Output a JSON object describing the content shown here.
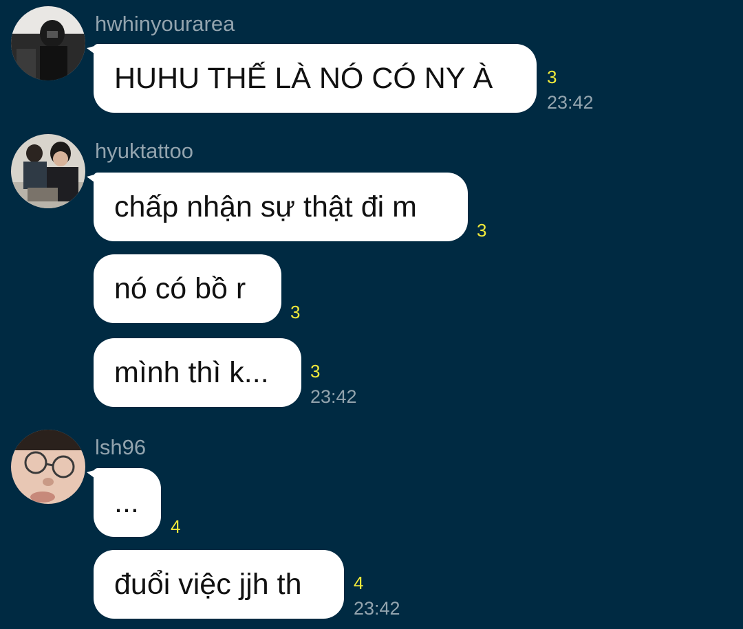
{
  "messages_groups": [
    {
      "username": "hwhinyourarea",
      "avatar_icon": "user-avatar-photo",
      "messages": [
        {
          "text": "HUHU THẾ LÀ NÓ CÓ NY À",
          "unread": "3",
          "time": "23:42"
        }
      ]
    },
    {
      "username": "hyuktattoo",
      "avatar_icon": "user-avatar-photo",
      "messages": [
        {
          "text": "chấp nhận sự thật đi m",
          "unread": "3"
        },
        {
          "text": "nó có bồ r",
          "unread": "3"
        },
        {
          "text": "mình thì k...",
          "unread": "3",
          "time": "23:42"
        }
      ]
    },
    {
      "username": "lsh96",
      "avatar_icon": "user-avatar-photo",
      "messages": [
        {
          "text": "...",
          "unread": "4"
        },
        {
          "text": "đuổi việc jjh th",
          "unread": "4",
          "time": "23:42"
        }
      ]
    }
  ],
  "colors": {
    "background": "#002a42",
    "bubble": "#ffffff",
    "unread": "#f1ea3a",
    "meta_text": "#93a4ae"
  }
}
